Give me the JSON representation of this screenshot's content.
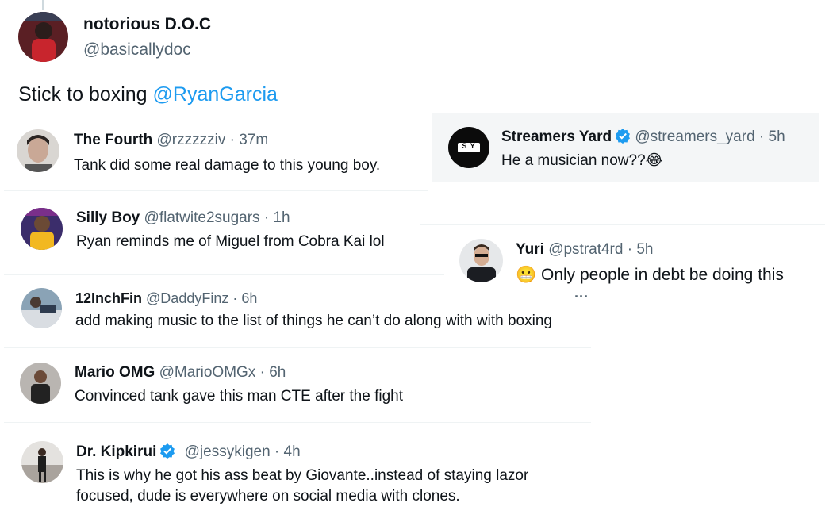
{
  "main_post": {
    "name": "notorious D.O.C",
    "handle": "@basicallydoc",
    "text": "Stick to boxing ",
    "mention": "@RyanGarcia"
  },
  "replies": [
    {
      "name": "The Fourth",
      "handle": "@rzzzzziv",
      "time": "· 37m",
      "text": "Tank did some real damage to this young boy."
    },
    {
      "name": "Streamers Yard",
      "handle": "@streamers_yard",
      "time": "· 5h",
      "text": "He a musician now??",
      "emoji": "😂",
      "logo": "S Y",
      "verified": true
    },
    {
      "name": "Silly Boy",
      "handle": "@flatwite2sugars",
      "time": "· 1h",
      "text": "Ryan reminds me of Miguel from Cobra Kai lol"
    },
    {
      "name": "Yuri",
      "handle": "@pstrat4rd",
      "time": "· 5h",
      "emoji": "😬",
      "text": " Only people in debt be doing this",
      "more": "···"
    },
    {
      "name": "12InchFin",
      "handle": "@DaddyFinz",
      "time": "· 6h",
      "text": "add making music to the list of things he can’t do along with with boxing"
    },
    {
      "name": "Mario OMG",
      "handle": "@MarioOMGx",
      "time": "· 6h",
      "text": "Convinced tank gave this man CTE after the fight"
    },
    {
      "name": "Dr. Kipkirui",
      "handle": "@jessykigen",
      "time": "· 4h",
      "text_line1": "This is why he got his ass beat by Giovante..instead of staying lazor",
      "text_line2": "focused, dude is everywhere on social media with clones.",
      "verified": true
    }
  ]
}
